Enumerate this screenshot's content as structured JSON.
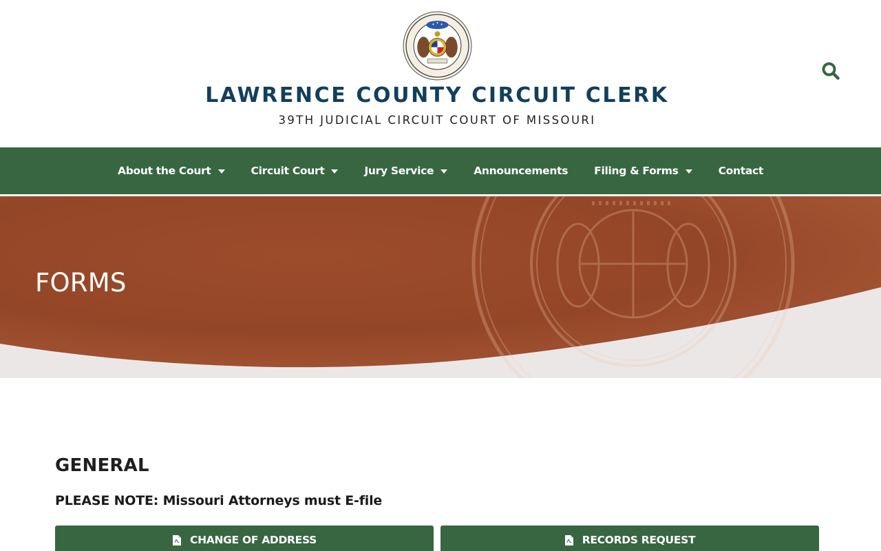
{
  "header": {
    "title": "LAWRENCE COUNTY CIRCUIT CLERK",
    "subtitle": "39TH JUDICIAL CIRCUIT COURT OF MISSOURI",
    "seal_icon": "missouri-state-seal"
  },
  "nav": {
    "items": [
      {
        "label": "About the Court",
        "has_dropdown": true
      },
      {
        "label": "Circuit Court",
        "has_dropdown": true
      },
      {
        "label": "Jury Service",
        "has_dropdown": true
      },
      {
        "label": "Announcements",
        "has_dropdown": false
      },
      {
        "label": "Filing & Forms",
        "has_dropdown": true
      },
      {
        "label": "Contact",
        "has_dropdown": false
      }
    ]
  },
  "hero": {
    "title": "FORMS"
  },
  "content": {
    "section_title": "GENERAL",
    "note": "PLEASE NOTE: Missouri Attorneys must E-file",
    "buttons": [
      {
        "label": "CHANGE OF ADDRESS",
        "icon": "pdf-file-icon"
      },
      {
        "label": "RECORDS REQUEST",
        "icon": "pdf-file-icon"
      }
    ]
  },
  "colors": {
    "brand_green": "#386641",
    "title_navy": "#123f5c",
    "hero_rust": "#9a4a2a",
    "hero_wave": "#ece7e7"
  }
}
